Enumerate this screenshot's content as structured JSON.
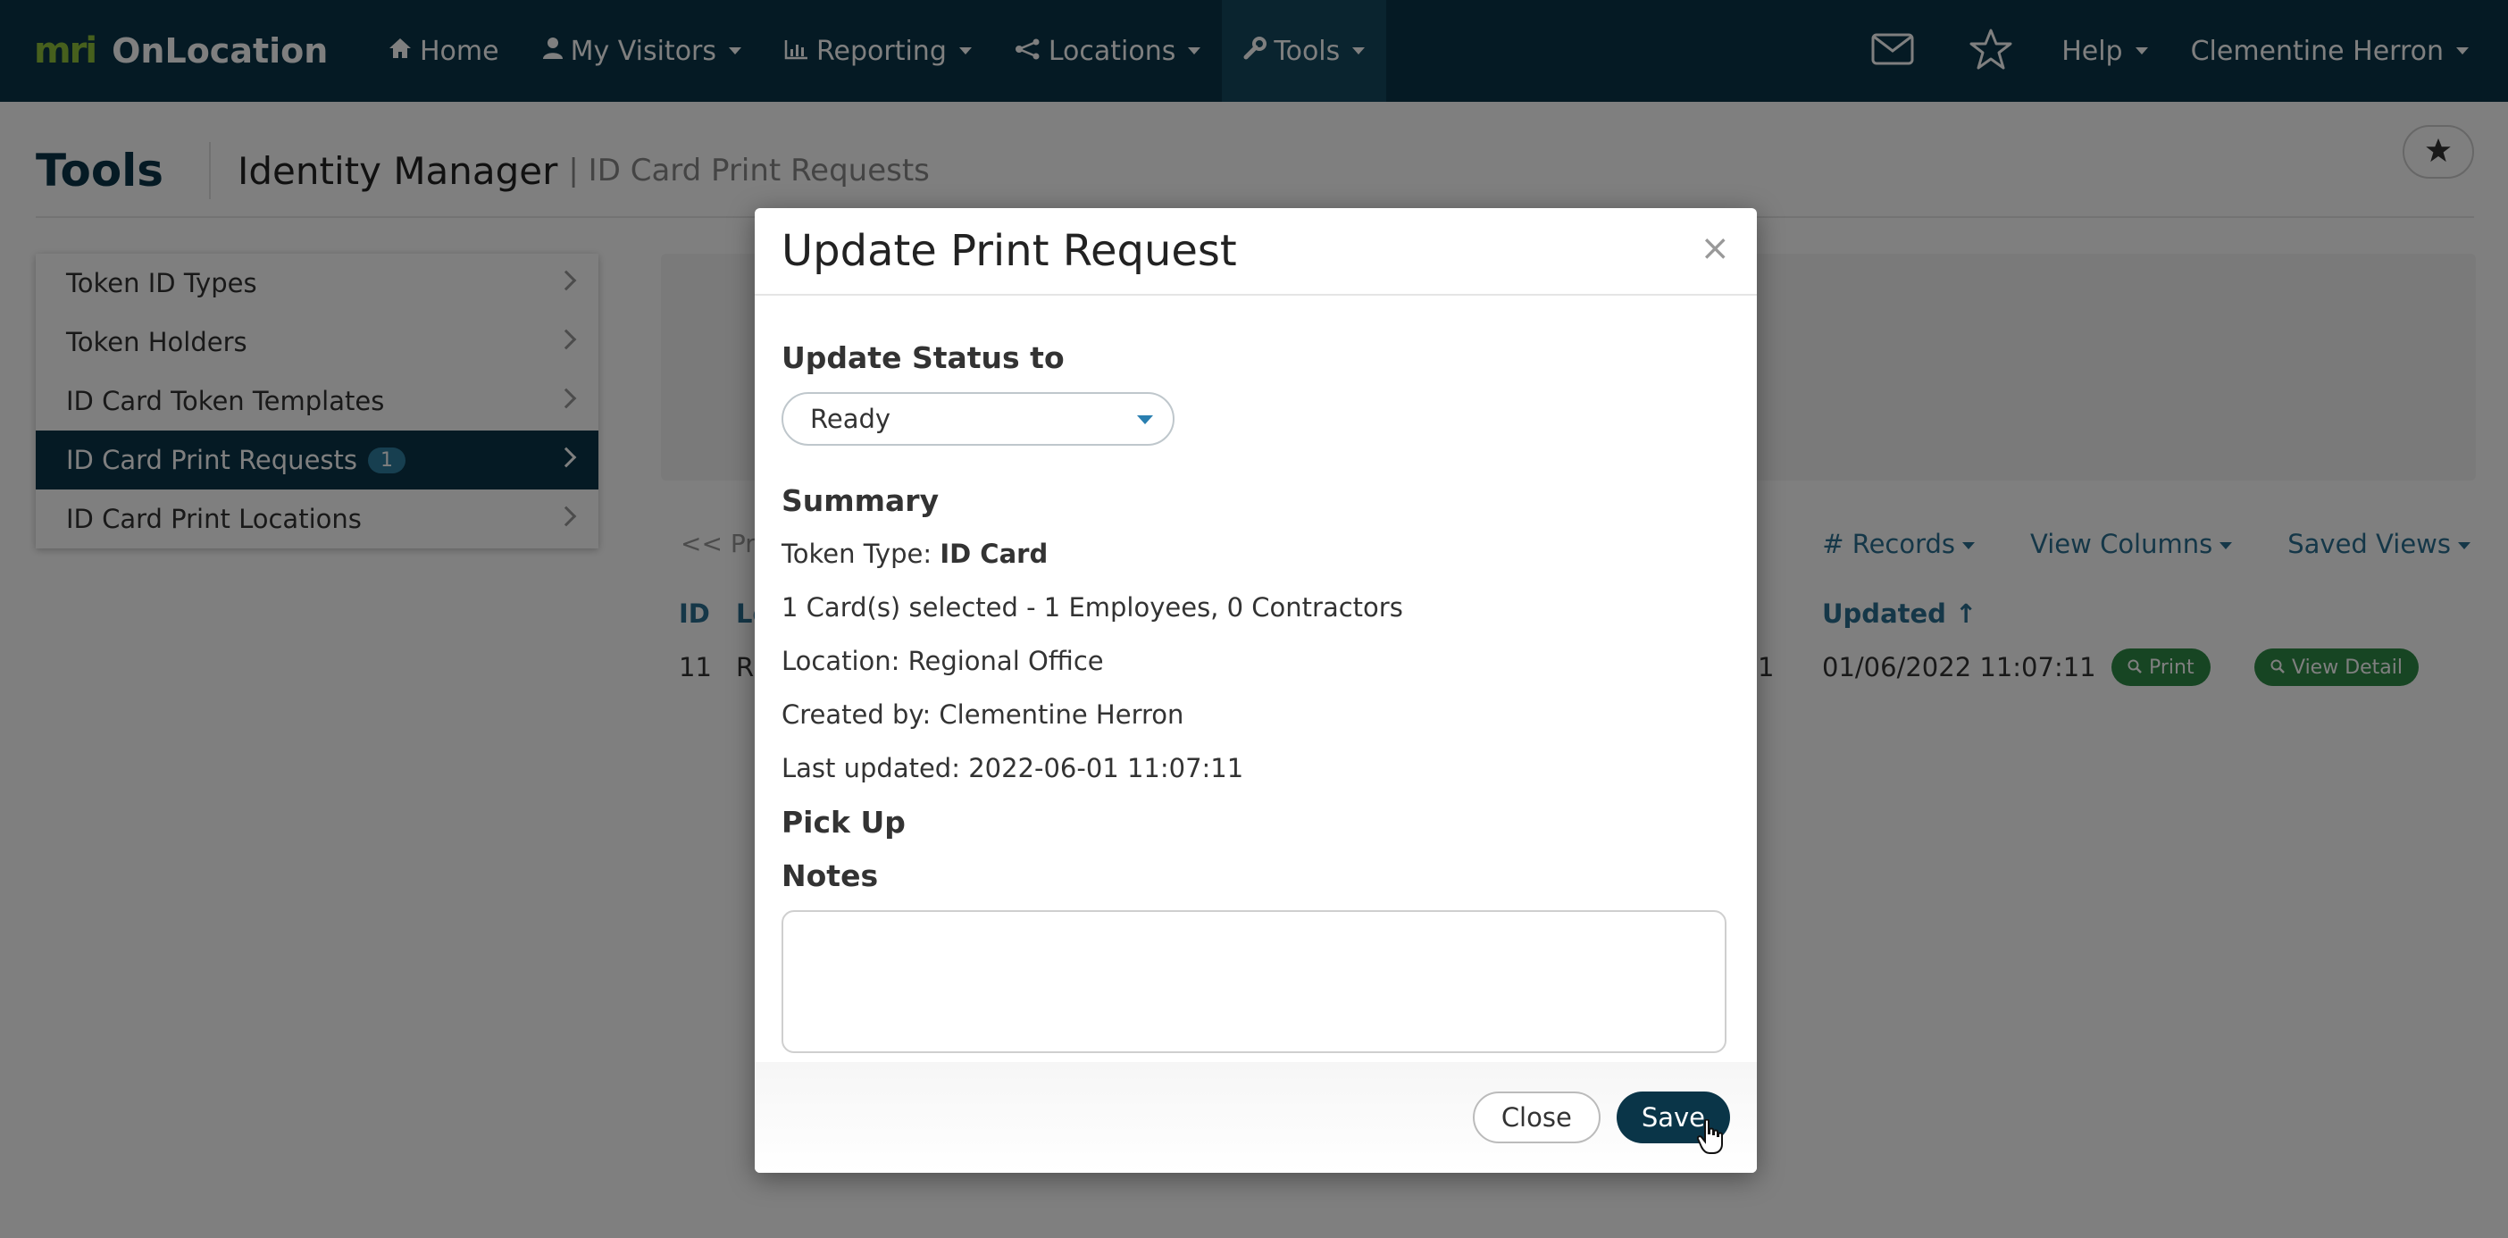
{
  "navbar": {
    "logo": "mri",
    "brand": "OnLocation",
    "items": [
      {
        "label": "Home",
        "icon": "home-icon"
      },
      {
        "label": "My Visitors",
        "icon": "user-icon"
      },
      {
        "label": "Reporting",
        "icon": "chart-icon"
      },
      {
        "label": "Locations",
        "icon": "network-icon"
      },
      {
        "label": "Tools",
        "icon": "wrench-icon"
      }
    ],
    "right": {
      "help": "Help",
      "user": "Clementine Herron"
    }
  },
  "page": {
    "title": "Tools",
    "section": "Identity Manager",
    "subsection": "| ID Card Print Requests"
  },
  "sidebar": {
    "items": [
      {
        "label": "Token ID Types"
      },
      {
        "label": "Token Holders"
      },
      {
        "label": "ID Card Token Templates"
      },
      {
        "label": "ID Card Print Requests",
        "badge": "1"
      },
      {
        "label": "ID Card Print Locations"
      }
    ]
  },
  "table": {
    "pager": "<< Pre",
    "toolbar": {
      "records": "# Records",
      "view_columns": "View Columns",
      "saved_views": "Saved Views"
    },
    "headers": {
      "id": "ID",
      "loc": "Lo",
      "updated": "Updated ↑"
    },
    "row": {
      "id": "11",
      "loc": "R",
      "partial": "1",
      "updated": "01/06/2022 11:07:11",
      "print_btn": "Print",
      "view_btn": "View Detail"
    }
  },
  "modal": {
    "title": "Update Print Request",
    "close_x": "×",
    "status_label": "Update Status to",
    "status_value": "Ready",
    "summary_heading": "Summary",
    "token_type_label": "Token Type:",
    "token_type_value": "ID Card",
    "cards_selected": "1 Card(s) selected - 1 Employees, 0 Contractors",
    "location": "Location: Regional Office",
    "created_by": "Created by: Clementine Herron",
    "last_updated": "Last updated: 2022-06-01 11:07:11",
    "pickup_heading": "Pick Up",
    "notes_heading": "Notes",
    "notes_value": "",
    "close_button": "Close",
    "save_button": "Save"
  },
  "colors": {
    "navbar": "#0a3548",
    "brand_accent": "#8fc03b",
    "link": "#2a6f90",
    "action_green": "#2e8a46"
  }
}
